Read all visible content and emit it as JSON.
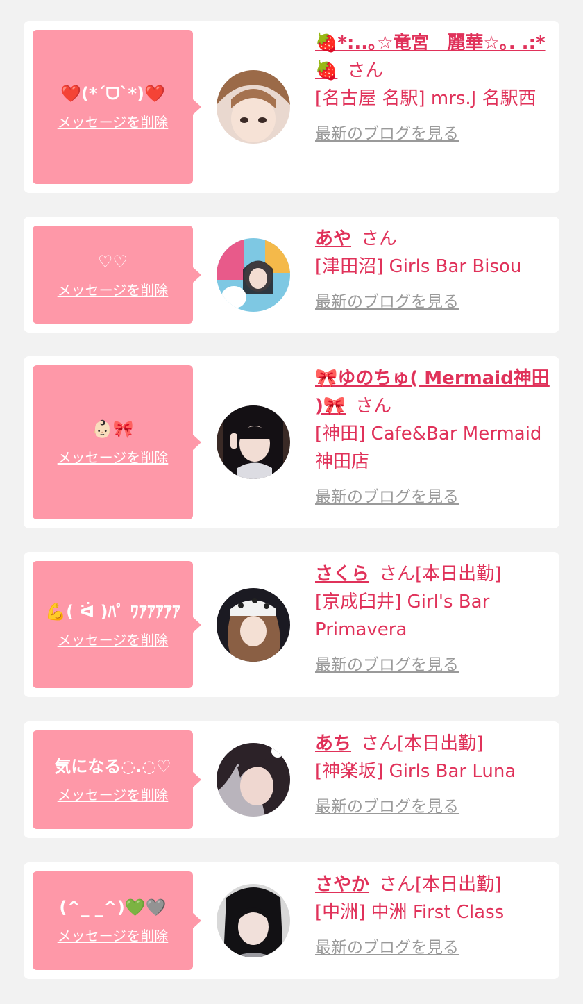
{
  "colors": {
    "accent": "#e0325a",
    "bubble": "#fe98a8",
    "muted": "#9a9a9a",
    "page_bg": "#f2f2f2"
  },
  "delete_label": "メッセージを削除",
  "blog_label": "最新のブログを見る",
  "items": [
    {
      "message": "❤️(*´ᗜ`*)❤️",
      "name": "🍓*:..｡☆竜宮　麗華☆｡. .:*🍓",
      "honorific": "さん",
      "tag": "",
      "shop": "[名古屋 名駅] mrs.J 名駅西",
      "avatar_icon": "avatar-photo-icon"
    },
    {
      "message": "♡♡",
      "name": "あや",
      "honorific": "さん",
      "tag": "",
      "shop": "[津田沼] Girls Bar Bisou",
      "avatar_icon": "avatar-photo-icon"
    },
    {
      "message": "👶🏻🎀",
      "name": "🎀ゆのちゅ( Mermaid神田 )🎀",
      "honorific": "さん",
      "tag": "",
      "shop": "[神田] Cafe&Bar Mermaid 神田店",
      "avatar_icon": "avatar-photo-icon"
    },
    {
      "message": "💪( ᐛ )ﾊﾟ ﾜｱｱｱｱｱ",
      "name": "さくら",
      "honorific": "さん",
      "tag": "[本日出勤]",
      "shop": "[京成臼井] Girl's Bar Primavera",
      "avatar_icon": "avatar-photo-icon"
    },
    {
      "message": "気になる◌.◌♡",
      "name": "あち",
      "honorific": "さん",
      "tag": "[本日出勤]",
      "shop": "[神楽坂] Girls Bar Luna",
      "avatar_icon": "avatar-photo-icon"
    },
    {
      "message": "(^_ _^)💚🩶",
      "name": "さやか",
      "honorific": "さん",
      "tag": "[本日出勤]",
      "shop": "[中洲] 中洲 First Class",
      "avatar_icon": "avatar-photo-icon"
    }
  ]
}
